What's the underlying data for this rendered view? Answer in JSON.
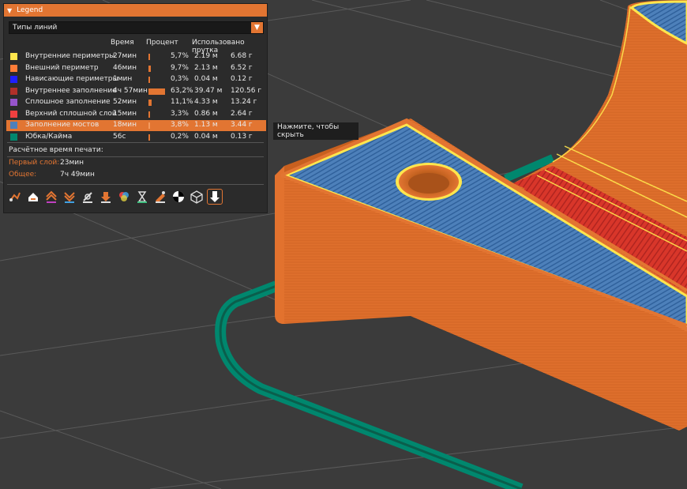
{
  "legend": {
    "title": "Legend",
    "dropdown_value": "Типы линий",
    "headers": {
      "time": "Время",
      "percent": "Процент",
      "used": "Использовано прутка"
    },
    "rows": [
      {
        "name": "Внутренние периметры",
        "time": "27мин",
        "percent": "5,7%",
        "fraction": 0.057,
        "meters": "2.19 м",
        "grams": "6.68 г",
        "color": "#ffe64d"
      },
      {
        "name": "Внешний периметр",
        "time": "46мин",
        "percent": "9,7%",
        "fraction": 0.097,
        "meters": "2.13 м",
        "grams": "6.52 г",
        "color": "#ff7d38"
      },
      {
        "name": "Нависающие периметры",
        "time": "1мин",
        "percent": "0,3%",
        "fraction": 0.003,
        "meters": "0.04 м",
        "grams": "0.12 г",
        "color": "#1f1fff"
      },
      {
        "name": "Внутреннее заполнение",
        "time": "4ч 57мин",
        "percent": "63,2%",
        "fraction": 0.632,
        "meters": "39.47 м",
        "grams": "120.56 г",
        "color": "#b03029"
      },
      {
        "name": "Сплошное заполнение",
        "time": "52мин",
        "percent": "11,1%",
        "fraction": 0.111,
        "meters": "4.33 м",
        "grams": "13.24 г",
        "color": "#9654cc"
      },
      {
        "name": "Верхний сплошной слой",
        "time": "15мин",
        "percent": "3,3%",
        "fraction": 0.033,
        "meters": "0.86 м",
        "grams": "2.64 г",
        "color": "#f04040"
      },
      {
        "name": "Заполнение мостов",
        "time": "18мин",
        "percent": "3,8%",
        "fraction": 0.038,
        "meters": "1.13 м",
        "grams": "3.44 г",
        "color": "#4d80ba",
        "highlighted": true
      },
      {
        "name": "Юбка/Кайма",
        "time": "56с",
        "percent": "0,2%",
        "fraction": 0.002,
        "meters": "0.04 м",
        "grams": "0.13 г",
        "color": "#00876e"
      }
    ],
    "estimated_label": "Расчётное время печати:",
    "first_layer_label": "Первый слой:",
    "first_layer_value": "23мин",
    "total_label": "Общее:",
    "total_value": "7ч 49мин",
    "accent_color": "#e27532",
    "toolbar_icons": [
      "travel-icon",
      "wipe-icon",
      "retractions-icon",
      "deretractions-icon",
      "seams-icon",
      "tool-changes-icon",
      "color-changes-icon",
      "pause-icon",
      "custom-gcode-icon",
      "center-of-gravity-icon",
      "shells-icon",
      "tool-marker-icon"
    ]
  },
  "tooltip": {
    "text": "Нажмите, чтобы скрыть"
  },
  "scene": {
    "object_color": "#e27532",
    "top_color": "#4d80ba",
    "perimeter_color": "#ffe64d",
    "infill_color": "#d8362a",
    "skirt_color": "#00876e",
    "bed_color": "#3b3b3b"
  }
}
